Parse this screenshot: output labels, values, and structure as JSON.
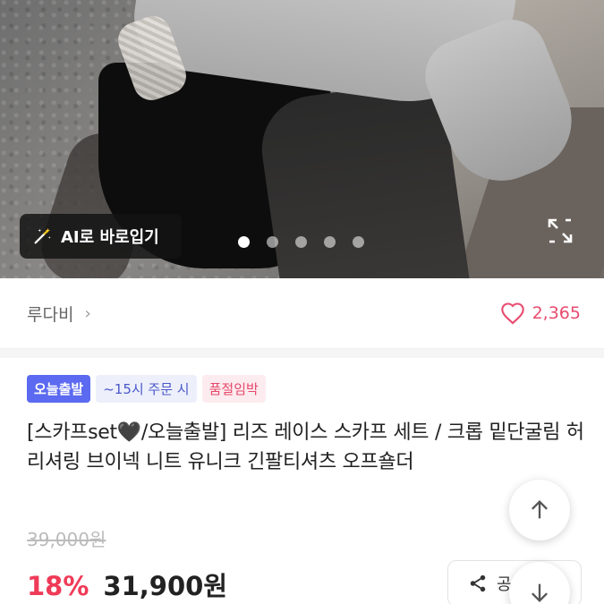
{
  "photo": {
    "ai_button_label": "AI로 바로입기",
    "ai_icon": "magic-wand-icon",
    "expand_icon": "expand-icon",
    "carousel_total": 5,
    "carousel_active": 1
  },
  "seller": {
    "name": "루다비",
    "like_count": "2,365",
    "like_icon": "heart-icon",
    "accent_color": "#e74c6f"
  },
  "badges": {
    "today": "오늘출발",
    "order_time": "~15시 주문 시",
    "soldout": "품절임박"
  },
  "product": {
    "title": "[스카프set🖤/오늘출발] 리즈 레이스 스카프  세트 / 크롭 밑단굴림 허리셔링 브이넥  니트 유니크 긴팔티셔츠 오프숄더",
    "original_price": "39,000원",
    "discount": "18%",
    "price": "31,900원",
    "discount_color": "#ef3b57"
  },
  "actions": {
    "share_label": "공",
    "share_icon": "share-icon",
    "scroll_up_icon": "arrow-up-icon",
    "scroll_down_icon": "arrow-down-icon"
  }
}
